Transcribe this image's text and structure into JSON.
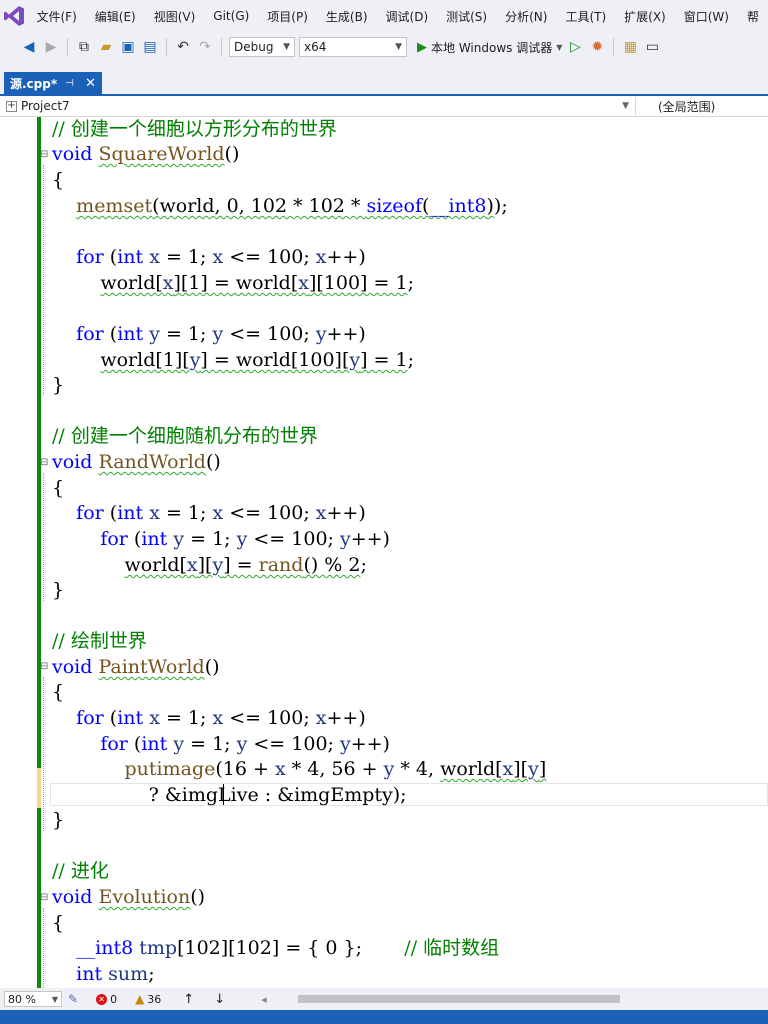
{
  "menu": [
    "文件(F)",
    "编辑(E)",
    "视图(V)",
    "Git(G)",
    "项目(P)",
    "生成(B)",
    "调试(D)",
    "测试(S)",
    "分析(N)",
    "工具(T)",
    "扩展(X)",
    "窗口(W)",
    "帮"
  ],
  "toolbar": {
    "config": "Debug",
    "platform": "x64",
    "run_label": "本地 Windows 调试器"
  },
  "tab": {
    "title": "源.cpp*",
    "pin": "⊣",
    "close": "✕"
  },
  "nav": {
    "project": "Project7",
    "scope": "(全局范围)"
  },
  "code": {
    "c1": "// 创建一个细胞以方形分布的世界",
    "c2": "// 创建一个细胞随机分布的世界",
    "c3": "// 绘制世界",
    "c4": "// 进化",
    "c5": "// 临时数组"
  },
  "status": {
    "zoom": "80 %",
    "errors": "0",
    "warnings": "36",
    "up": "↑",
    "down": "↓",
    "left": "◂"
  },
  "colors": {
    "accent": "#1c61b8",
    "keyword": "#0000ff",
    "comment": "#008000",
    "function": "#74531f",
    "changed_bar": "#108810"
  }
}
